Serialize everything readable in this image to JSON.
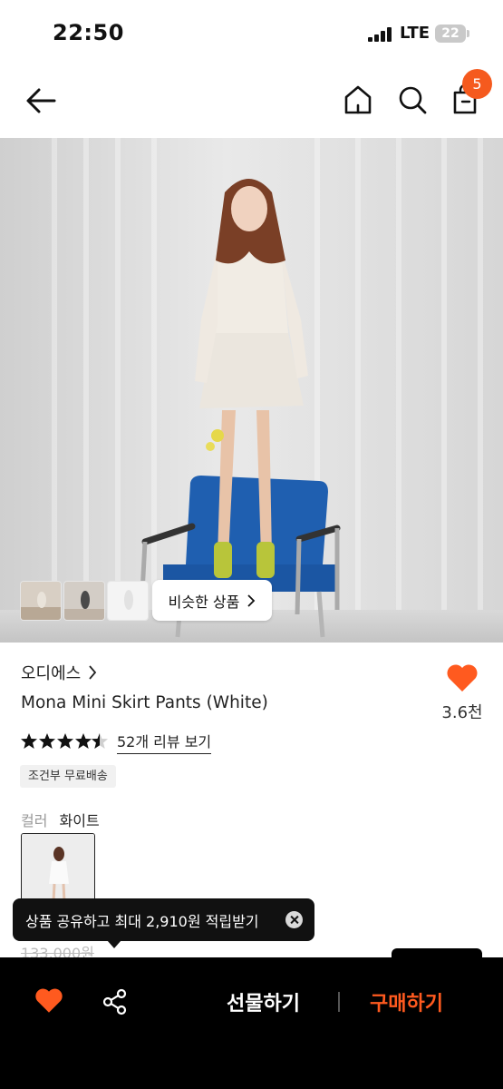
{
  "status_bar": {
    "time": "22:50",
    "network": "LTE",
    "battery": "22"
  },
  "header": {
    "icons": [
      "back-arrow-icon",
      "home-icon",
      "search-icon",
      "shopping-bag-icon"
    ],
    "cart_count": "5"
  },
  "gallery": {
    "thumbnail_count": 3,
    "similar_button_label": "비슷한 상품"
  },
  "product": {
    "brand": "오디에스",
    "name": "Mona Mini Skirt Pants (White)",
    "like_count": "3.6천",
    "rating": 4.5,
    "review_link": "52개 리뷰 보기",
    "shipping_badge": "조건부 무료배송",
    "color_label": "컬러",
    "color_value": "화이트",
    "original_price": "133,000원"
  },
  "tooltip": {
    "text": "상품 공유하고 최대 2,910원 적립받기"
  },
  "bottom_bar": {
    "gift_label": "선물하기",
    "buy_label": "구매하기"
  },
  "colors": {
    "accent": "#f55a1e",
    "buy_text": "#ff5a1f",
    "bottom_bar_bg": "#000000",
    "heart": "#ff5a1f"
  }
}
